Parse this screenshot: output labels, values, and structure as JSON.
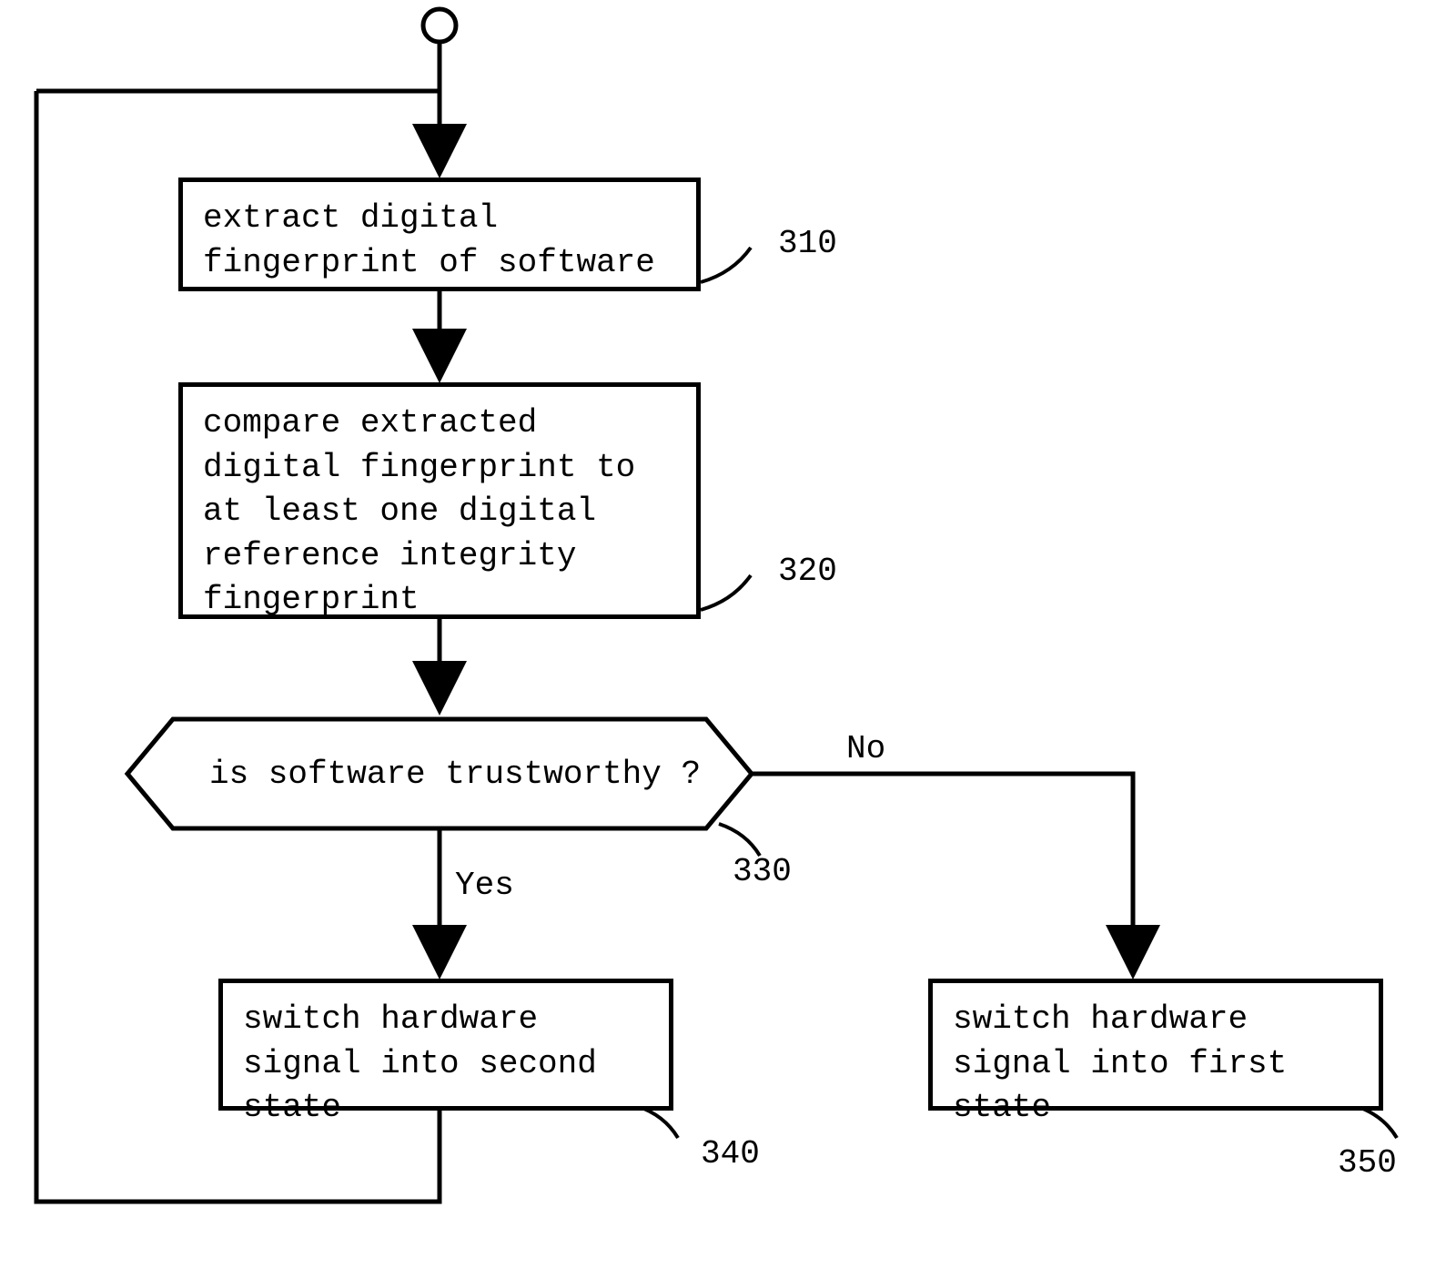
{
  "chart_data": {
    "type": "flowchart",
    "nodes": [
      {
        "id": "start",
        "kind": "start",
        "text": ""
      },
      {
        "id": "n310",
        "kind": "process",
        "text": "extract digital fingerprint of software",
        "ref": "310"
      },
      {
        "id": "n320",
        "kind": "process",
        "text": "compare extracted digital fingerprint to at least one digital reference integrity fingerprint",
        "ref": "320"
      },
      {
        "id": "n330",
        "kind": "decision",
        "text": "is software trustworthy ?",
        "ref": "330"
      },
      {
        "id": "n340",
        "kind": "process",
        "text": "switch hardware signal into second state",
        "ref": "340"
      },
      {
        "id": "n350",
        "kind": "process",
        "text": "switch hardware signal into first state",
        "ref": "350"
      }
    ],
    "edges": [
      {
        "from": "start",
        "to": "n310",
        "label": ""
      },
      {
        "from": "n310",
        "to": "n320",
        "label": ""
      },
      {
        "from": "n320",
        "to": "n330",
        "label": ""
      },
      {
        "from": "n330",
        "to": "n340",
        "label": "Yes"
      },
      {
        "from": "n330",
        "to": "n350",
        "label": "No"
      },
      {
        "from": "n340",
        "to": "n310",
        "label": ""
      }
    ]
  },
  "boxes": {
    "b310": "extract digital fingerprint of software",
    "b320": "compare extracted digital fingerprint to at least one digital reference integrity fingerprint",
    "b330": "is software trustworthy ?",
    "b340": "switch hardware signal into second state",
    "b350": "switch hardware signal into first state"
  },
  "refs": {
    "r310": "310",
    "r320": "320",
    "r330": "330",
    "r340": "340",
    "r350": "350"
  },
  "edge_labels": {
    "yes": "Yes",
    "no": "No"
  }
}
